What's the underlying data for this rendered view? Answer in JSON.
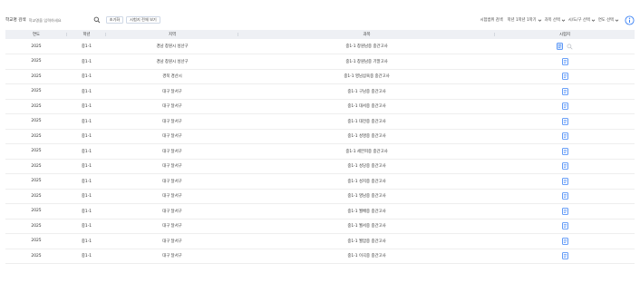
{
  "toolbar": {
    "search_label": "학교명 검색",
    "search_placeholder": "학교명을 입력하세요",
    "reset_label": "초기화",
    "all_papers_label": "시험지 전체 보기",
    "filters": [
      {
        "label": "시험범위 검색",
        "value": ""
      },
      {
        "label": "",
        "value": "학년 1학년 1학기"
      },
      {
        "label": "",
        "value": "과목 선택"
      },
      {
        "label": "",
        "value": "시/도/구 선택"
      },
      {
        "label": "",
        "value": "연도 선택"
      }
    ]
  },
  "table": {
    "headers": [
      "연도",
      "학년",
      "지역",
      "과목",
      "시험지"
    ],
    "rows": [
      {
        "year": "2025",
        "grade": "중1-1",
        "region": "경남 창원시 성산구",
        "subject": "중1-1 창원남중 중간고사",
        "selected": true
      },
      {
        "year": "2025",
        "grade": "중1-1",
        "region": "경남 창원시 성산구",
        "subject": "중1-1 창원남중 기말고사",
        "selected": false
      },
      {
        "year": "2025",
        "grade": "중1-1",
        "region": "경북 경산시",
        "subject": "중1-1 영남삼육중 중간고사",
        "selected": false
      },
      {
        "year": "2025",
        "grade": "중1-1",
        "region": "대구 달서구",
        "subject": "중1-1 구남중 중간고사",
        "selected": false
      },
      {
        "year": "2025",
        "grade": "중1-1",
        "region": "대구 달서구",
        "subject": "중1-1 대서중 중간고사",
        "selected": false
      },
      {
        "year": "2025",
        "grade": "중1-1",
        "region": "대구 달서구",
        "subject": "중1-1 대전중 중간고사",
        "selected": false
      },
      {
        "year": "2025",
        "grade": "중1-1",
        "region": "대구 달서구",
        "subject": "중1-1 성명중 중간고사",
        "selected": false
      },
      {
        "year": "2025",
        "grade": "중1-1",
        "region": "대구 달서구",
        "subject": "중1-1 세븐피중 중간고사",
        "selected": false
      },
      {
        "year": "2025",
        "grade": "중1-1",
        "region": "대구 달서구",
        "subject": "중1-1 성당중 중간고사",
        "selected": false
      },
      {
        "year": "2025",
        "grade": "중1-1",
        "region": "대구 달서구",
        "subject": "중1-1 성지중 중간고사",
        "selected": false
      },
      {
        "year": "2025",
        "grade": "중1-1",
        "region": "대구 달서구",
        "subject": "중1-1 영남중 중간고사",
        "selected": false
      },
      {
        "year": "2025",
        "grade": "중1-1",
        "region": "대구 달서구",
        "subject": "중1-1 월배중 중간고사",
        "selected": false
      },
      {
        "year": "2025",
        "grade": "중1-1",
        "region": "대구 달서구",
        "subject": "중1-1 월서중 중간고사",
        "selected": false
      },
      {
        "year": "2025",
        "grade": "중1-1",
        "region": "대구 달서구",
        "subject": "중1-1 월암중 중간고사",
        "selected": false
      },
      {
        "year": "2025",
        "grade": "중1-1",
        "region": "대구 달서구",
        "subject": "중1-1 이곡중 중간고사",
        "selected": false
      }
    ]
  },
  "colors": {
    "accent": "#3b82f6",
    "header_bg": "#eef0f4",
    "selected_icon_bg": "#dbe8fb"
  },
  "icons": {
    "search": "search-icon",
    "chevron": "chevron-down-icon",
    "info": "info-icon",
    "paper": "document-icon",
    "preview": "zoom-icon"
  }
}
